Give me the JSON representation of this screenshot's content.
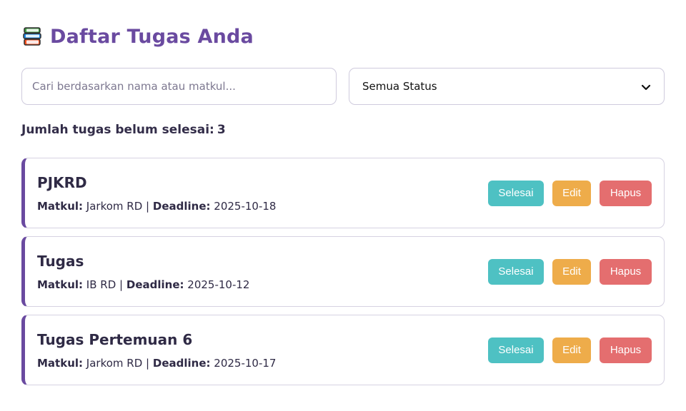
{
  "header": {
    "icon": "books-icon",
    "title": "Daftar Tugas Anda"
  },
  "filters": {
    "search_placeholder": "Cari berdasarkan nama atau matkul...",
    "search_value": "",
    "status_selected": "Semua Status"
  },
  "summary": {
    "label": "Jumlah tugas belum selesai:",
    "count": "3"
  },
  "task_labels": {
    "matkul": "Matkul:",
    "separator": "|",
    "deadline": "Deadline:"
  },
  "tasks": [
    {
      "name": "PJKRD",
      "matkul": "Jarkom RD",
      "deadline": "2025-10-18"
    },
    {
      "name": "Tugas",
      "matkul": "IB RD",
      "deadline": "2025-10-12"
    },
    {
      "name": "Tugas Pertemuan 6",
      "matkul": "Jarkom RD",
      "deadline": "2025-10-17"
    }
  ],
  "actions": {
    "done_label": "Selesai",
    "edit_label": "Edit",
    "delete_label": "Hapus"
  },
  "colors": {
    "accent": "#6a4aa0",
    "done": "#4ec1c3",
    "edit": "#eeac4a",
    "delete": "#e46e6f"
  }
}
